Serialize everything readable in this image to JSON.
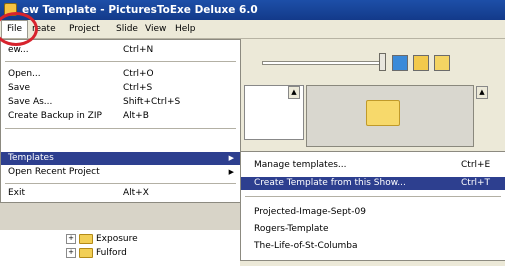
{
  "window": {
    "title": "ew Template - PicturesToExe Deluxe 6.0"
  },
  "menubar": [
    {
      "label": "File",
      "open": true
    },
    {
      "label": "reate"
    },
    {
      "label": "Project"
    },
    {
      "label": "Slide"
    },
    {
      "label": "View"
    },
    {
      "label": "Help"
    }
  ],
  "file_menu": {
    "items": [
      {
        "label": "ew...",
        "shortcut": "Ctrl+N"
      },
      {
        "label": "Open...",
        "shortcut": "Ctrl+O"
      },
      {
        "label": "Save",
        "shortcut": "Ctrl+S"
      },
      {
        "label": "Save As...",
        "shortcut": "Shift+Ctrl+S"
      },
      {
        "label": "Create Backup in ZIP",
        "shortcut": "Alt+B"
      },
      {
        "label": "Templates",
        "shortcut": "",
        "highlighted": true,
        "submenu": true
      },
      {
        "label": "Open Recent Project",
        "shortcut": "",
        "submenu": true
      },
      {
        "label": "Exit",
        "shortcut": "Alt+X"
      }
    ]
  },
  "templates_submenu": {
    "items": [
      {
        "label": "Manage templates...",
        "shortcut": "Ctrl+E"
      },
      {
        "label": "Create Template from this Show...",
        "shortcut": "Ctrl+T",
        "highlighted": true
      },
      {
        "label": "Projected-Image-Sept-09",
        "shortcut": ""
      },
      {
        "label": "Rogers-Template",
        "shortcut": ""
      },
      {
        "label": "The-Life-of-St-Columba",
        "shortcut": ""
      }
    ]
  },
  "folder_tree": [
    {
      "label": "Exposure"
    },
    {
      "label": "Fulford"
    }
  ],
  "colors": {
    "highlight": "#2d3f8f",
    "title_bar": "#1d4fa8",
    "annotation_circle": "#d7232d"
  },
  "icons": [
    "app-icon",
    "folder-icon",
    "submenu-arrow-icon",
    "expander-plus-icon"
  ]
}
